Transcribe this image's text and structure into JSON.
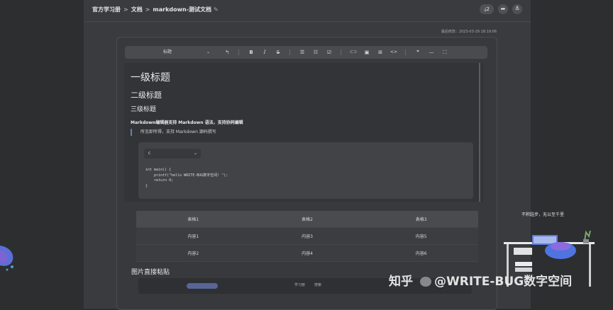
{
  "breadcrumb": {
    "items": [
      "官方学习册",
      "文档",
      "markdown-测试文档"
    ],
    "separator": ">",
    "edit_icon": "edit-icon"
  },
  "top_right": {
    "download_count": "⤓2",
    "icons": [
      "share-icon",
      "collapse-icon"
    ]
  },
  "last_modified": "最后修改：2023-03-29 18:19:06",
  "toolbar": {
    "heading_select": "标题",
    "buttons": [
      "undo",
      "bold",
      "italic",
      "strikethrough",
      "bulleted-list",
      "numbered-list",
      "task-list",
      "link",
      "image",
      "table",
      "code",
      "quote",
      "divider",
      "fullscreen"
    ],
    "labels": {
      "undo": "↰",
      "bold": "B",
      "italic": "I",
      "strikethrough": "S",
      "bulleted_list": "☰",
      "numbered_list": "☷",
      "task_list": "☑",
      "link": "⊂⊃",
      "image": "▣",
      "table": "⊞",
      "code": "<>",
      "quote": "❞",
      "divider": "—",
      "fullscreen": "⛶"
    }
  },
  "document": {
    "h1": "一级标题",
    "h2": "二级标题",
    "h3": "三级标题",
    "bold_line": "Markdown编辑器支持 Markdown 语法，支持协同编辑",
    "quote": "所见即所得，支持 Markdown 源码撰写",
    "code_language": "c",
    "code": "int main() {\n    printf(\"hello WRITE-BUG数字空间! \");\n    return 0;\n}",
    "table": {
      "header": [
        "表格1",
        "表格2",
        "表格3"
      ],
      "rows": [
        [
          "内容1",
          "内容3",
          "内容5"
        ],
        [
          "内容2",
          "内容4",
          "内容6"
        ]
      ]
    },
    "image_heading": "图片直接粘贴",
    "image_preview_texts": [
      "学习册",
      "搜索"
    ]
  },
  "motto": "不积跬步，无以至千里",
  "watermark": {
    "platform": "知乎",
    "handle": "@WRITE-BUG数字空间"
  },
  "colors": {
    "background": "#2d2e30",
    "page": "#3a3b3e",
    "toolbar": "#4a4b4f",
    "quote_bar": "#6b7fa8"
  }
}
